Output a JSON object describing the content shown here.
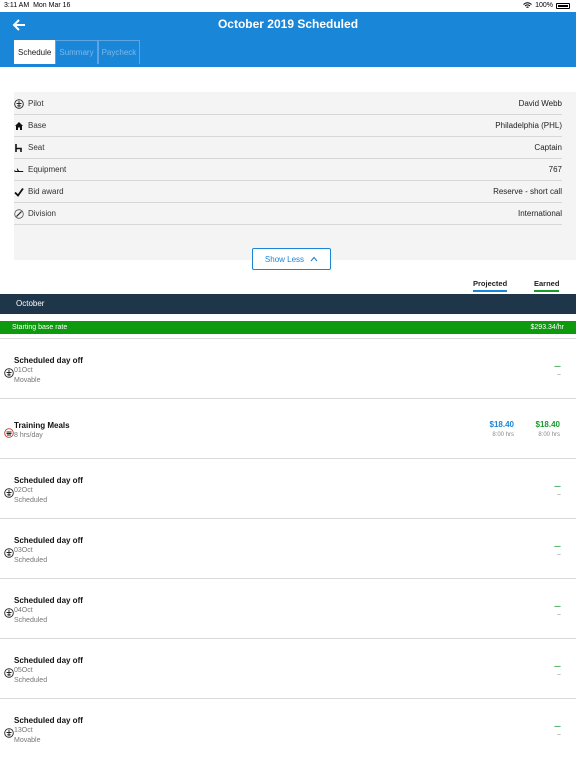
{
  "status_bar": {
    "time": "3:11 AM",
    "date": "Mon Mar 16",
    "battery": "100%"
  },
  "header": {
    "title": "October 2019 Scheduled",
    "tabs": [
      {
        "label": "Schedule",
        "active": true
      },
      {
        "label": "Summary",
        "active": false
      },
      {
        "label": "Paycheck",
        "active": false
      }
    ]
  },
  "details": [
    {
      "icon": "pilot-badge-icon",
      "label": "Pilot",
      "value": "David Webb"
    },
    {
      "icon": "home-icon",
      "label": "Base",
      "value": "Philadelphia (PHL)"
    },
    {
      "icon": "seat-icon",
      "label": "Seat",
      "value": "Captain"
    },
    {
      "icon": "airplane-icon",
      "label": "Equipment",
      "value": "767"
    },
    {
      "icon": "checkmark-icon",
      "label": "Bid award",
      "value": "Reserve - short call"
    },
    {
      "icon": "division-icon",
      "label": "Division",
      "value": "International"
    }
  ],
  "show_less_label": "Show Less",
  "columns": {
    "projected": "Projected",
    "earned": "Earned"
  },
  "month": "October",
  "base_rate": {
    "label": "Starting base rate",
    "value": "$293.34/hr"
  },
  "entries": [
    {
      "type": "dayoff",
      "title": "Scheduled day off",
      "date": "01Oct",
      "status": "Movable",
      "dash": "---",
      "dash_sub": "---"
    },
    {
      "type": "training",
      "title": "Training Meals",
      "date": "8 hrs/day",
      "projected": "$18.40",
      "projected_sub": "8:00 hrs",
      "earned": "$18.40",
      "earned_sub": "8:00 hrs"
    },
    {
      "type": "dayoff",
      "title": "Scheduled day off",
      "date": "02Oct",
      "status": "Scheduled",
      "dash": "---",
      "dash_sub": "---"
    },
    {
      "type": "dayoff",
      "title": "Scheduled day off",
      "date": "03Oct",
      "status": "Scheduled",
      "dash": "---",
      "dash_sub": "---"
    },
    {
      "type": "dayoff",
      "title": "Scheduled day off",
      "date": "04Oct",
      "status": "Scheduled",
      "dash": "---",
      "dash_sub": "---"
    },
    {
      "type": "dayoff",
      "title": "Scheduled day off",
      "date": "05Oct",
      "status": "Scheduled",
      "dash": "---",
      "dash_sub": "---"
    },
    {
      "type": "dayoff",
      "title": "Scheduled day off",
      "date": "13Oct",
      "status": "Movable",
      "dash": "---",
      "dash_sub": "---"
    }
  ],
  "colors": {
    "header": "#1a86d8",
    "month_bar": "#1f354a",
    "base_rate": "#0e9a0e",
    "earned": "#1a9a2e",
    "projected": "#1a86d8"
  }
}
